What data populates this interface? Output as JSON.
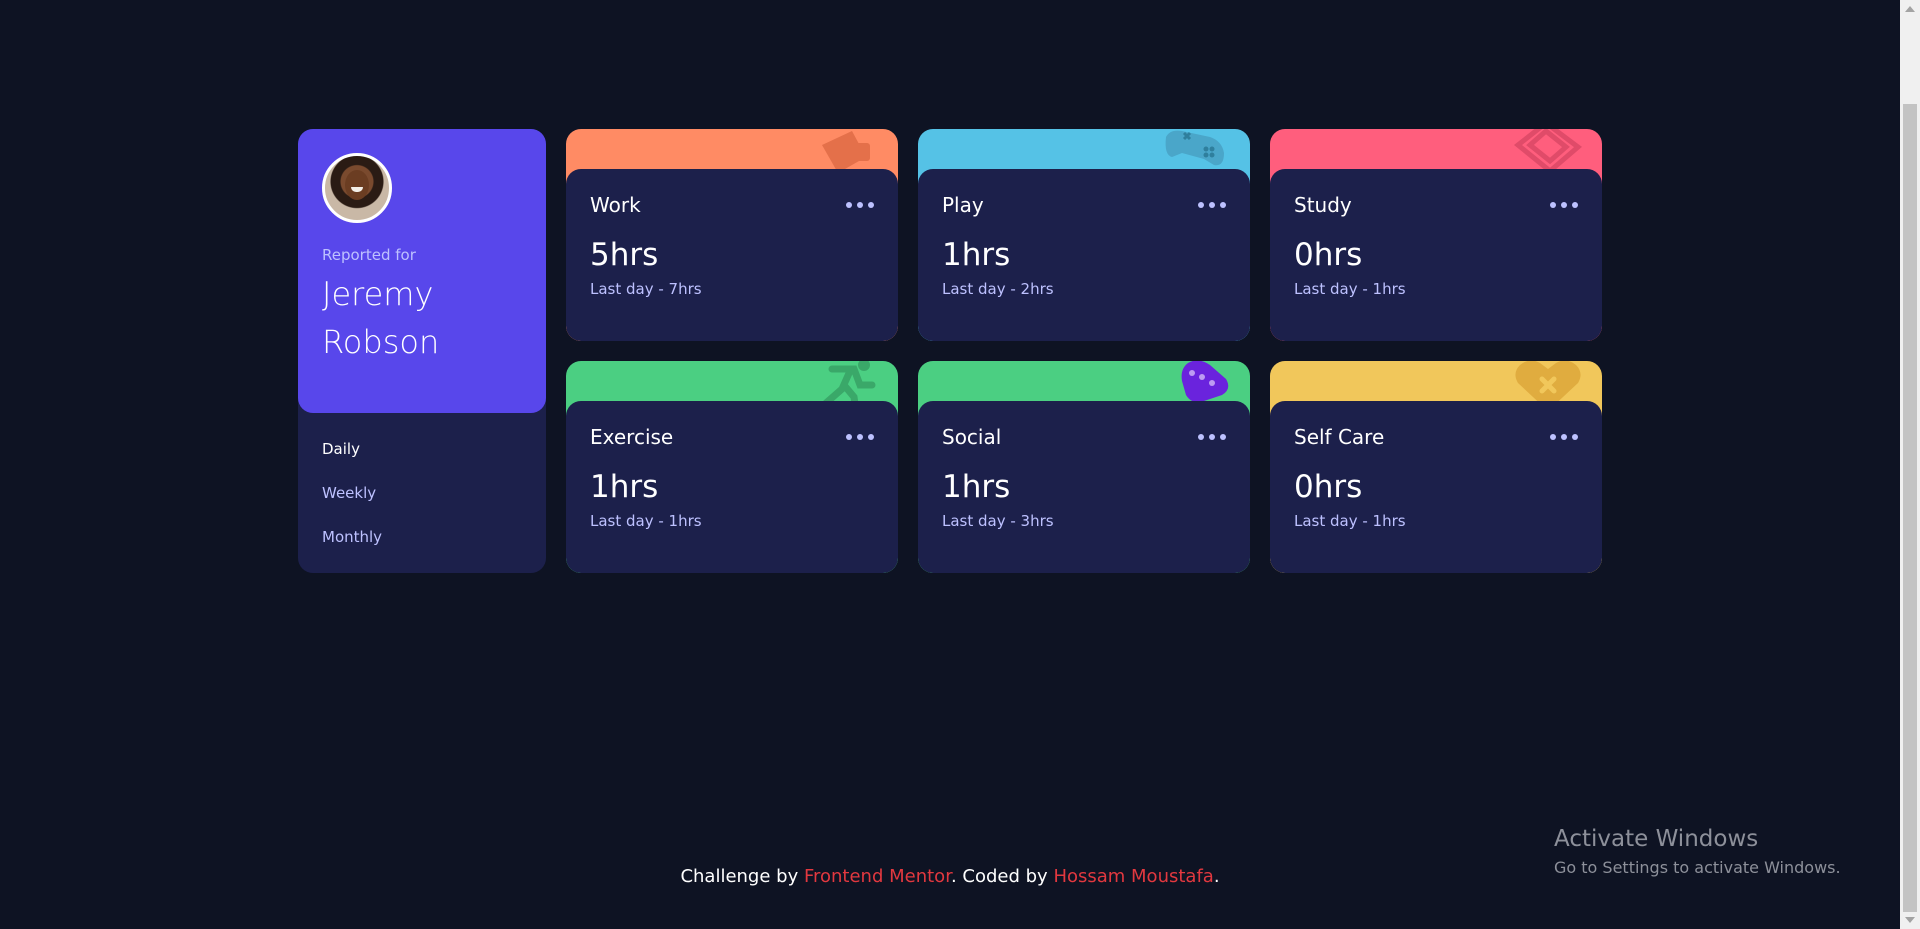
{
  "profile": {
    "reported_label": "Reported for",
    "name_line1": "Jeremy",
    "name_line2": "Robson"
  },
  "timeframes": [
    "Daily",
    "Weekly",
    "Monthly"
  ],
  "active_timeframe": "Daily",
  "cards": [
    {
      "title": "Work",
      "current": "5hrs",
      "previous": "Last day - 7hrs",
      "color": "#ff8b64",
      "icon": "work-icon"
    },
    {
      "title": "Play",
      "current": "1hrs",
      "previous": "Last day - 2hrs",
      "color": "#55c2e6",
      "icon": "play-icon"
    },
    {
      "title": "Study",
      "current": "0hrs",
      "previous": "Last day - 1hrs",
      "color": "#ff5e7d",
      "icon": "study-icon"
    },
    {
      "title": "Exercise",
      "current": "1hrs",
      "previous": "Last day - 1hrs",
      "color": "#4bcf82",
      "icon": "exercise-icon"
    },
    {
      "title": "Social",
      "current": "1hrs",
      "previous": "Last day - 3hrs",
      "color": "#4bcf82",
      "icon": "social-icon"
    },
    {
      "title": "Self Care",
      "current": "0hrs",
      "previous": "Last day - 1hrs",
      "color": "#f1c75b",
      "icon": "self-care-icon"
    }
  ],
  "footer": {
    "prefix": "Challenge by ",
    "link1": "Frontend Mentor",
    "middle": ". Coded by ",
    "link2": "Hossam Moustafa",
    "suffix": "."
  },
  "watermark": {
    "line1": "Activate Windows",
    "line2": "Go to Settings to activate Windows."
  },
  "colors": {
    "background": "#0e1323",
    "panel": "#1c204b",
    "accent": "#5847eb",
    "muted_text": "#bdc1ff",
    "link": "#e2383f"
  }
}
